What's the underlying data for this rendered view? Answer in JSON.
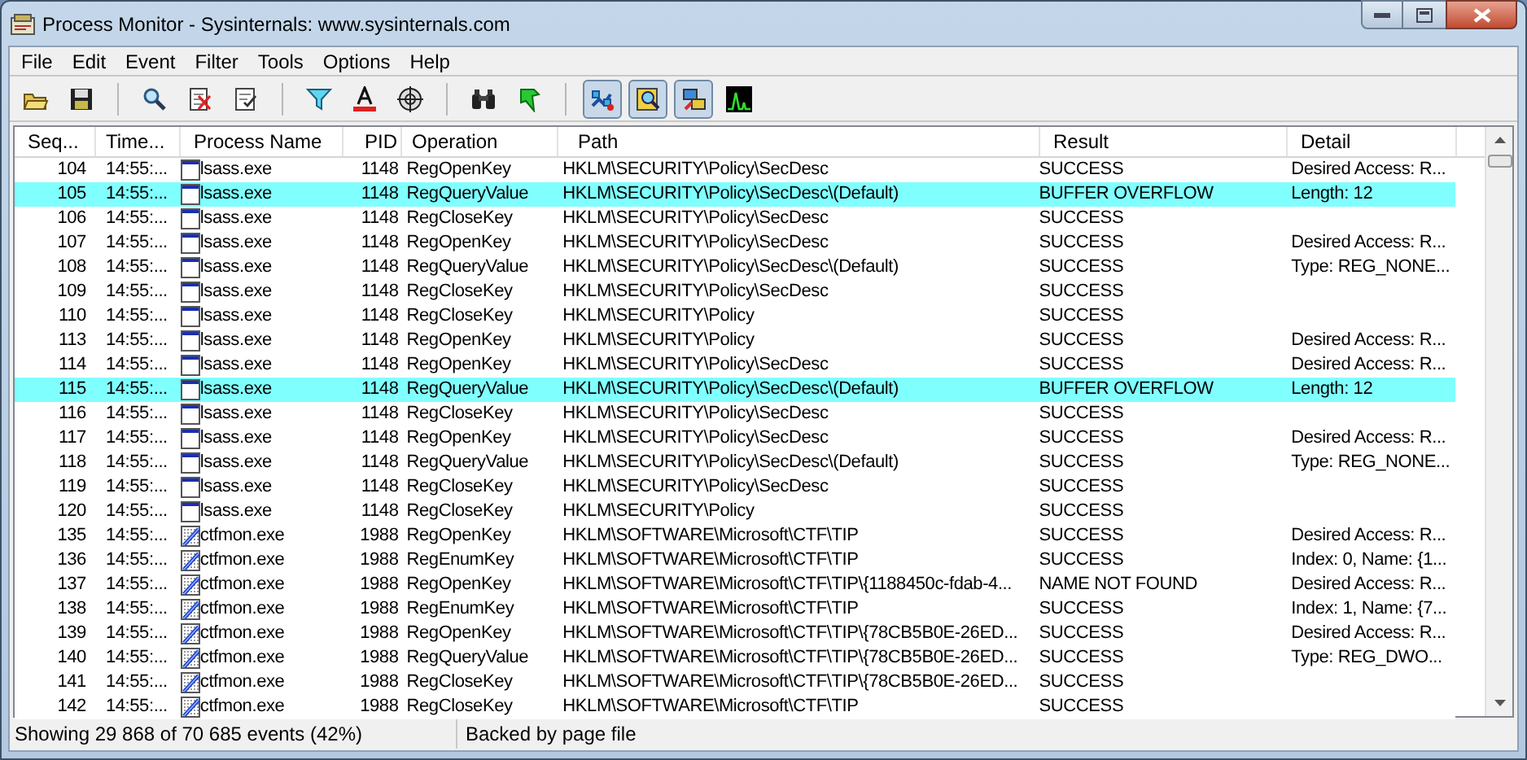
{
  "window": {
    "title": "Process Monitor - Sysinternals: www.sysinternals.com"
  },
  "menu": [
    "File",
    "Edit",
    "Event",
    "Filter",
    "Tools",
    "Options",
    "Help"
  ],
  "toolbar": [
    {
      "kind": "open"
    },
    {
      "kind": "save"
    },
    {
      "kind": "separator"
    },
    {
      "kind": "magnifier"
    },
    {
      "kind": "erase"
    },
    {
      "kind": "clear"
    },
    {
      "kind": "separator"
    },
    {
      "kind": "filter"
    },
    {
      "kind": "highlight"
    },
    {
      "kind": "target"
    },
    {
      "kind": "separator"
    },
    {
      "kind": "find"
    },
    {
      "kind": "jump"
    },
    {
      "kind": "separator"
    },
    {
      "kind": "registry",
      "on": true
    },
    {
      "kind": "filesystem",
      "on": true
    },
    {
      "kind": "network",
      "on": true
    },
    {
      "kind": "profiling",
      "on": false
    }
  ],
  "table": {
    "columns": [
      "Seq...",
      "Time...",
      "Process Name",
      "PID",
      "Operation",
      "Path",
      "Result",
      "Detail"
    ],
    "rows": [
      {
        "seq": "104",
        "time": "14:55:...",
        "process": "lsass.exe",
        "kind": "window",
        "pid": "1148",
        "operation": "RegOpenKey",
        "path": "HKLM\\SECURITY\\Policy\\SecDesc",
        "result": "SUCCESS",
        "detail": "Desired Access: R...",
        "highlighted": false
      },
      {
        "seq": "105",
        "time": "14:55:...",
        "process": "lsass.exe",
        "kind": "window",
        "pid": "1148",
        "operation": "RegQueryValue",
        "path": "HKLM\\SECURITY\\Policy\\SecDesc\\(Default)",
        "result": "BUFFER OVERFLOW",
        "detail": "Length: 12",
        "highlighted": true
      },
      {
        "seq": "106",
        "time": "14:55:...",
        "process": "lsass.exe",
        "kind": "window",
        "pid": "1148",
        "operation": "RegCloseKey",
        "path": "HKLM\\SECURITY\\Policy\\SecDesc",
        "result": "SUCCESS",
        "detail": "",
        "highlighted": false
      },
      {
        "seq": "107",
        "time": "14:55:...",
        "process": "lsass.exe",
        "kind": "window",
        "pid": "1148",
        "operation": "RegOpenKey",
        "path": "HKLM\\SECURITY\\Policy\\SecDesc",
        "result": "SUCCESS",
        "detail": "Desired Access: R...",
        "highlighted": false
      },
      {
        "seq": "108",
        "time": "14:55:...",
        "process": "lsass.exe",
        "kind": "window",
        "pid": "1148",
        "operation": "RegQueryValue",
        "path": "HKLM\\SECURITY\\Policy\\SecDesc\\(Default)",
        "result": "SUCCESS",
        "detail": "Type: REG_NONE...",
        "highlighted": false
      },
      {
        "seq": "109",
        "time": "14:55:...",
        "process": "lsass.exe",
        "kind": "window",
        "pid": "1148",
        "operation": "RegCloseKey",
        "path": "HKLM\\SECURITY\\Policy\\SecDesc",
        "result": "SUCCESS",
        "detail": "",
        "highlighted": false
      },
      {
        "seq": "110",
        "time": "14:55:...",
        "process": "lsass.exe",
        "kind": "window",
        "pid": "1148",
        "operation": "RegCloseKey",
        "path": "HKLM\\SECURITY\\Policy",
        "result": "SUCCESS",
        "detail": "",
        "highlighted": false
      },
      {
        "seq": "113",
        "time": "14:55:...",
        "process": "lsass.exe",
        "kind": "window",
        "pid": "1148",
        "operation": "RegOpenKey",
        "path": "HKLM\\SECURITY\\Policy",
        "result": "SUCCESS",
        "detail": "Desired Access: R...",
        "highlighted": false
      },
      {
        "seq": "114",
        "time": "14:55:...",
        "process": "lsass.exe",
        "kind": "window",
        "pid": "1148",
        "operation": "RegOpenKey",
        "path": "HKLM\\SECURITY\\Policy\\SecDesc",
        "result": "SUCCESS",
        "detail": "Desired Access: R...",
        "highlighted": false
      },
      {
        "seq": "115",
        "time": "14:55:...",
        "process": "lsass.exe",
        "kind": "window",
        "pid": "1148",
        "operation": "RegQueryValue",
        "path": "HKLM\\SECURITY\\Policy\\SecDesc\\(Default)",
        "result": "BUFFER OVERFLOW",
        "detail": "Length: 12",
        "highlighted": true
      },
      {
        "seq": "116",
        "time": "14:55:...",
        "process": "lsass.exe",
        "kind": "window",
        "pid": "1148",
        "operation": "RegCloseKey",
        "path": "HKLM\\SECURITY\\Policy\\SecDesc",
        "result": "SUCCESS",
        "detail": "",
        "highlighted": false
      },
      {
        "seq": "117",
        "time": "14:55:...",
        "process": "lsass.exe",
        "kind": "window",
        "pid": "1148",
        "operation": "RegOpenKey",
        "path": "HKLM\\SECURITY\\Policy\\SecDesc",
        "result": "SUCCESS",
        "detail": "Desired Access: R...",
        "highlighted": false
      },
      {
        "seq": "118",
        "time": "14:55:...",
        "process": "lsass.exe",
        "kind": "window",
        "pid": "1148",
        "operation": "RegQueryValue",
        "path": "HKLM\\SECURITY\\Policy\\SecDesc\\(Default)",
        "result": "SUCCESS",
        "detail": "Type: REG_NONE...",
        "highlighted": false
      },
      {
        "seq": "119",
        "time": "14:55:...",
        "process": "lsass.exe",
        "kind": "window",
        "pid": "1148",
        "operation": "RegCloseKey",
        "path": "HKLM\\SECURITY\\Policy\\SecDesc",
        "result": "SUCCESS",
        "detail": "",
        "highlighted": false
      },
      {
        "seq": "120",
        "time": "14:55:...",
        "process": "lsass.exe",
        "kind": "window",
        "pid": "1148",
        "operation": "RegCloseKey",
        "path": "HKLM\\SECURITY\\Policy",
        "result": "SUCCESS",
        "detail": "",
        "highlighted": false
      },
      {
        "seq": "135",
        "time": "14:55:...",
        "process": "ctfmon.exe",
        "kind": "pen",
        "pid": "1988",
        "operation": "RegOpenKey",
        "path": "HKLM\\SOFTWARE\\Microsoft\\CTF\\TIP",
        "result": "SUCCESS",
        "detail": "Desired Access: R...",
        "highlighted": false
      },
      {
        "seq": "136",
        "time": "14:55:...",
        "process": "ctfmon.exe",
        "kind": "pen",
        "pid": "1988",
        "operation": "RegEnumKey",
        "path": "HKLM\\SOFTWARE\\Microsoft\\CTF\\TIP",
        "result": "SUCCESS",
        "detail": "Index: 0, Name: {1...",
        "highlighted": false
      },
      {
        "seq": "137",
        "time": "14:55:...",
        "process": "ctfmon.exe",
        "kind": "pen",
        "pid": "1988",
        "operation": "RegOpenKey",
        "path": "HKLM\\SOFTWARE\\Microsoft\\CTF\\TIP\\{1188450c-fdab-4...",
        "result": "NAME NOT FOUND",
        "detail": "Desired Access: R...",
        "highlighted": false
      },
      {
        "seq": "138",
        "time": "14:55:...",
        "process": "ctfmon.exe",
        "kind": "pen",
        "pid": "1988",
        "operation": "RegEnumKey",
        "path": "HKLM\\SOFTWARE\\Microsoft\\CTF\\TIP",
        "result": "SUCCESS",
        "detail": "Index: 1, Name: {7...",
        "highlighted": false
      },
      {
        "seq": "139",
        "time": "14:55:...",
        "process": "ctfmon.exe",
        "kind": "pen",
        "pid": "1988",
        "operation": "RegOpenKey",
        "path": "HKLM\\SOFTWARE\\Microsoft\\CTF\\TIP\\{78CB5B0E-26ED...",
        "result": "SUCCESS",
        "detail": "Desired Access: R...",
        "highlighted": false
      },
      {
        "seq": "140",
        "time": "14:55:...",
        "process": "ctfmon.exe",
        "kind": "pen",
        "pid": "1988",
        "operation": "RegQueryValue",
        "path": "HKLM\\SOFTWARE\\Microsoft\\CTF\\TIP\\{78CB5B0E-26ED...",
        "result": "SUCCESS",
        "detail": "Type: REG_DWO...",
        "highlighted": false
      },
      {
        "seq": "141",
        "time": "14:55:...",
        "process": "ctfmon.exe",
        "kind": "pen",
        "pid": "1988",
        "operation": "RegCloseKey",
        "path": "HKLM\\SOFTWARE\\Microsoft\\CTF\\TIP\\{78CB5B0E-26ED...",
        "result": "SUCCESS",
        "detail": "",
        "highlighted": false
      },
      {
        "seq": "142",
        "time": "14:55:...",
        "process": "ctfmon.exe",
        "kind": "pen",
        "pid": "1988",
        "operation": "RegCloseKey",
        "path": "HKLM\\SOFTWARE\\Microsoft\\CTF\\TIP",
        "result": "SUCCESS",
        "detail": "",
        "highlighted": false
      }
    ]
  },
  "status_bar": [
    "Showing 29 868 of 70 685 events (42%)",
    "Backed by page file"
  ]
}
